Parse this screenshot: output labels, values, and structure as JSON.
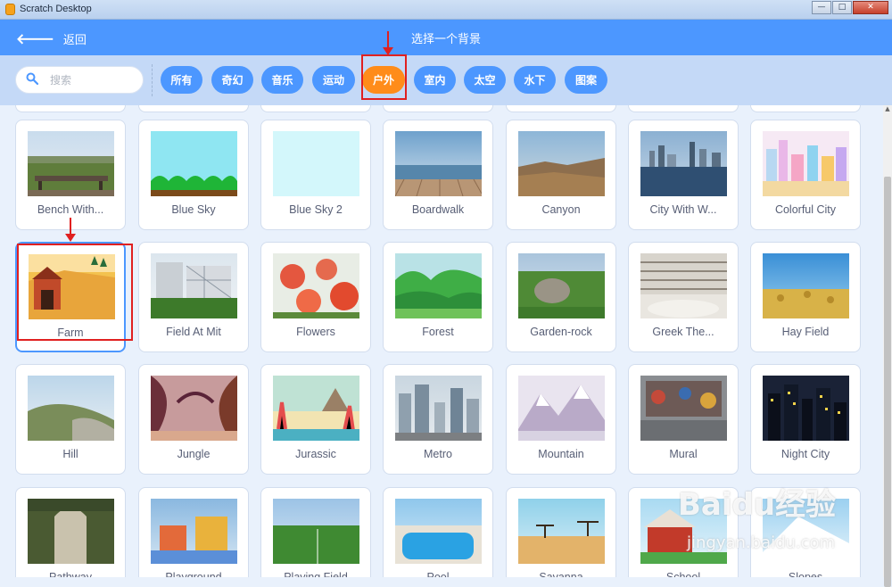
{
  "window": {
    "title": "Scratch Desktop",
    "min": "—",
    "max": "□",
    "close": "✕"
  },
  "header": {
    "back_label": "返回",
    "title": "选择一个背景"
  },
  "search": {
    "placeholder": "搜索"
  },
  "tags": [
    {
      "label": "所有",
      "active": false
    },
    {
      "label": "奇幻",
      "active": false
    },
    {
      "label": "音乐",
      "active": false
    },
    {
      "label": "运动",
      "active": false
    },
    {
      "label": "户外",
      "active": true
    },
    {
      "label": "室内",
      "active": false
    },
    {
      "label": "太空",
      "active": false
    },
    {
      "label": "水下",
      "active": false
    },
    {
      "label": "图案",
      "active": false
    }
  ],
  "backdrops": [
    {
      "name": "Bench With...",
      "thumb": "bench"
    },
    {
      "name": "Blue Sky",
      "thumb": "bluesky"
    },
    {
      "name": "Blue Sky 2",
      "thumb": "bluesky2"
    },
    {
      "name": "Boardwalk",
      "thumb": "boardwalk"
    },
    {
      "name": "Canyon",
      "thumb": "canyon"
    },
    {
      "name": "City With W...",
      "thumb": "citywater"
    },
    {
      "name": "Colorful City",
      "thumb": "colorful"
    },
    {
      "name": "Farm",
      "thumb": "farm",
      "selected": true
    },
    {
      "name": "Field At Mit",
      "thumb": "mit"
    },
    {
      "name": "Flowers",
      "thumb": "flowers"
    },
    {
      "name": "Forest",
      "thumb": "forest"
    },
    {
      "name": "Garden-rock",
      "thumb": "gardenrock"
    },
    {
      "name": "Greek The...",
      "thumb": "greek"
    },
    {
      "name": "Hay Field",
      "thumb": "hay"
    },
    {
      "name": "Hill",
      "thumb": "hill"
    },
    {
      "name": "Jungle",
      "thumb": "jungle"
    },
    {
      "name": "Jurassic",
      "thumb": "jurassic"
    },
    {
      "name": "Metro",
      "thumb": "metro"
    },
    {
      "name": "Mountain",
      "thumb": "mountain"
    },
    {
      "name": "Mural",
      "thumb": "mural"
    },
    {
      "name": "Night City",
      "thumb": "night"
    },
    {
      "name": "Pathway",
      "thumb": "pathway"
    },
    {
      "name": "Playground",
      "thumb": "playground"
    },
    {
      "name": "Playing Field",
      "thumb": "playing"
    },
    {
      "name": "Pool",
      "thumb": "pool"
    },
    {
      "name": "Savanna",
      "thumb": "savanna"
    },
    {
      "name": "School",
      "thumb": "school"
    },
    {
      "name": "Slopes",
      "thumb": "slopes"
    }
  ],
  "watermark": {
    "line1": "Baidu经验",
    "line2": "jingyan.baidu.com"
  }
}
